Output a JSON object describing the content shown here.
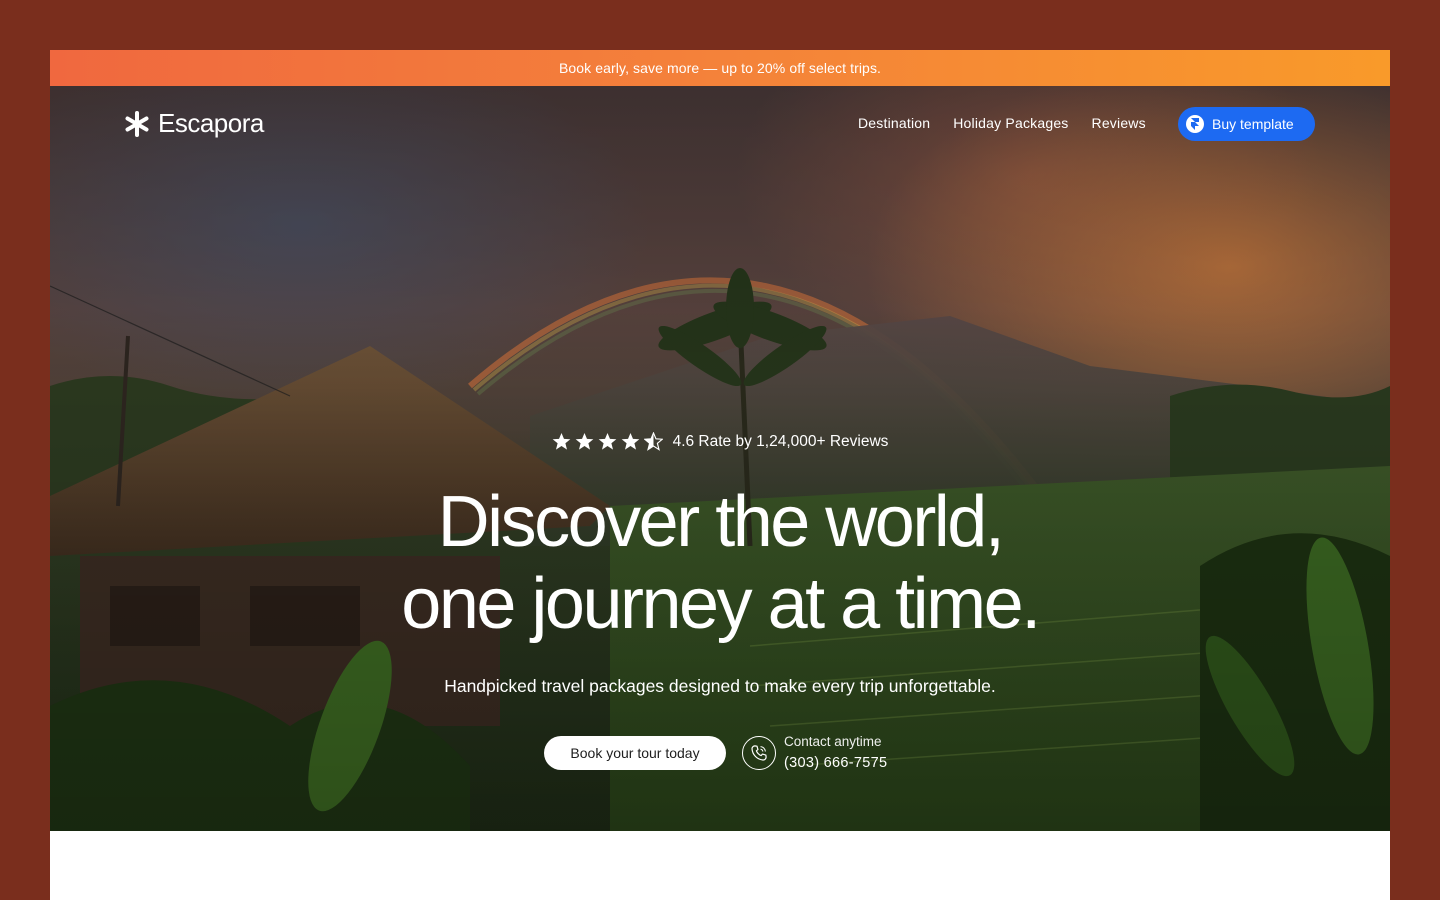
{
  "promo": {
    "text": "Book early, save more — up to 20% off select trips."
  },
  "brand": {
    "name": "Escapora",
    "logo_icon": "asterisk-icon"
  },
  "nav": {
    "links": [
      "Destination",
      "Holiday Packages",
      "Reviews"
    ],
    "buy_button": {
      "label": "Buy template",
      "icon": "framer-icon"
    }
  },
  "hero": {
    "rating": {
      "value": 4.6,
      "max": 5,
      "text": "4.6 Rate by 1,24,000+ Reviews"
    },
    "headline_line1": "Discover the world,",
    "headline_line2": "one journey at a time.",
    "subtitle": "Handpicked travel packages designed to make every trip unforgettable.",
    "cta_label": "Book your tour today",
    "contact": {
      "label": "Contact anytime",
      "phone": "(303) 666-7575",
      "icon": "phone-icon"
    }
  },
  "colors": {
    "background": "#7a2e1d",
    "promo_gradient_start": "#f0683f",
    "promo_gradient_end": "#f99a2a",
    "accent_blue": "#1d6af2"
  }
}
